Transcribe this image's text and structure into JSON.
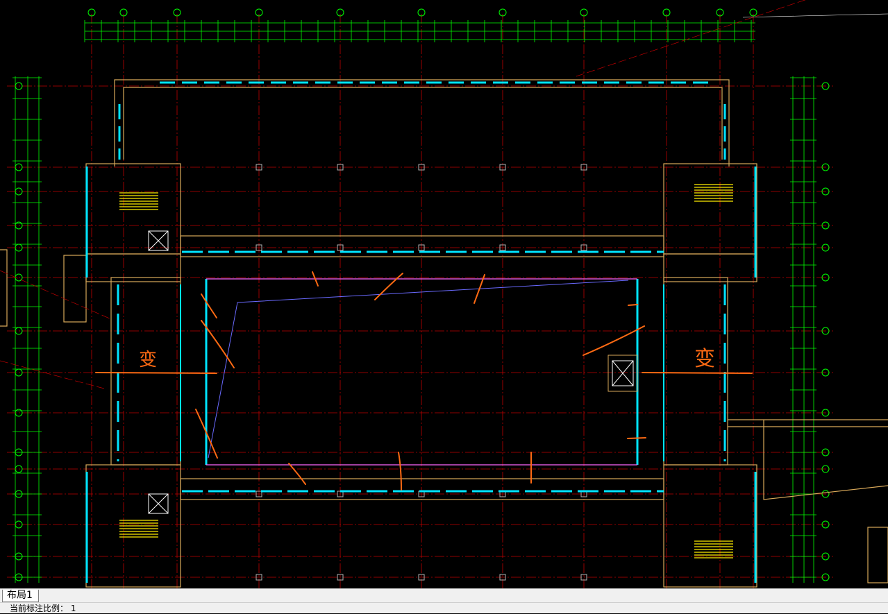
{
  "layout_tab": {
    "label": "布局1"
  },
  "status": {
    "label": "当前标注比例：",
    "value": "1"
  },
  "annotation": {
    "text": "变"
  },
  "colors": {
    "background": "#000000",
    "axis_line": "#c00000",
    "dimension": "#00ff00",
    "wall": "#00e5ff",
    "wall_frame": "#d9a95a",
    "redline": "#ff6a13",
    "stair": "#ffee00",
    "column": "#b3b3b3"
  }
}
